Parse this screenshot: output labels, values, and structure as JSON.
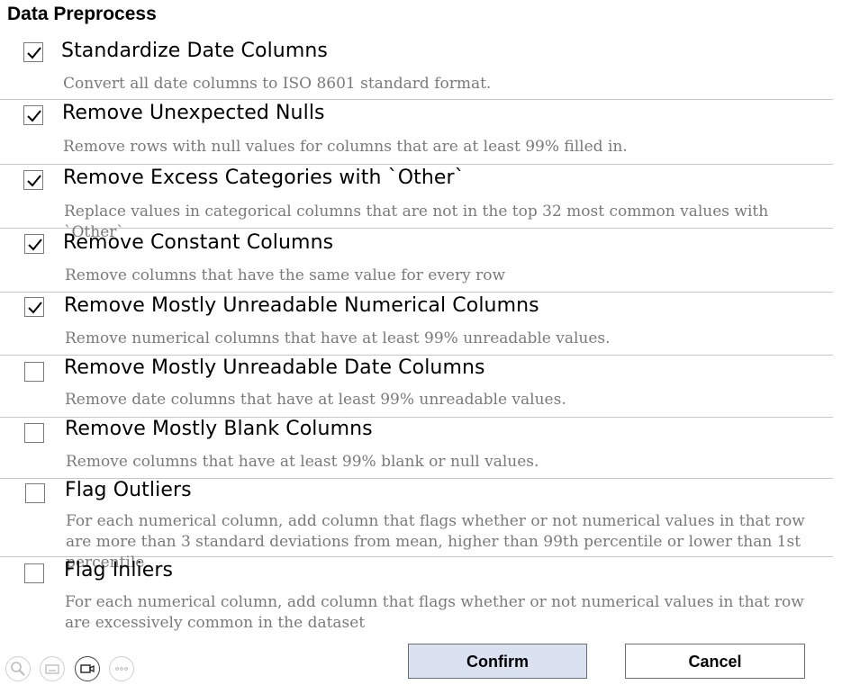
{
  "dialog": {
    "title": "Data Preprocess"
  },
  "options": [
    {
      "label": "Standardize Date Columns",
      "description": "Convert all date columns to ISO 8601 standard format.",
      "checked": true
    },
    {
      "label": "Remove Unexpected Nulls",
      "description": "Remove rows with null values for columns that are at least 99% filled in.",
      "checked": true
    },
    {
      "label": "Remove Excess Categories with `Other`",
      "description": "Replace values in categorical columns that are not in the top 32 most common values with `Other`",
      "checked": true
    },
    {
      "label": "Remove Constant Columns",
      "description": "Remove columns that have the same value for every row",
      "checked": true
    },
    {
      "label": "Remove Mostly Unreadable Numerical Columns",
      "description": "Remove numerical columns that have at least 99% unreadable values.",
      "checked": true
    },
    {
      "label": "Remove Mostly Unreadable Date Columns",
      "description": "Remove date columns that have at least 99% unreadable values.",
      "checked": false
    },
    {
      "label": "Remove Mostly Blank Columns",
      "description": "Remove columns that have at least 99% blank or null values.",
      "checked": false
    },
    {
      "label": "Flag Outliers",
      "description": "For each numerical column, add column that flags whether or not numerical values in that row are more than 3 standard deviations from mean, higher than 99th percentile or lower than 1st percentile",
      "checked": false
    },
    {
      "label": "Flag Inliers",
      "description": "For each numerical column, add column that flags whether or not numerical values in that row are excessively common in the dataset",
      "checked": false
    }
  ],
  "buttons": {
    "confirm_label": "Confirm",
    "cancel_label": "Cancel"
  },
  "bottom_icons": [
    {
      "icon": "search-icon",
      "active": false
    },
    {
      "icon": "keyboard-icon",
      "active": false
    },
    {
      "icon": "video-icon",
      "active": true
    },
    {
      "icon": "more-icon",
      "active": false
    }
  ],
  "colors": {
    "confirm_bg": "#dae2f2",
    "description_text": "#7a7a7a",
    "divider": "#c8c8c8"
  }
}
